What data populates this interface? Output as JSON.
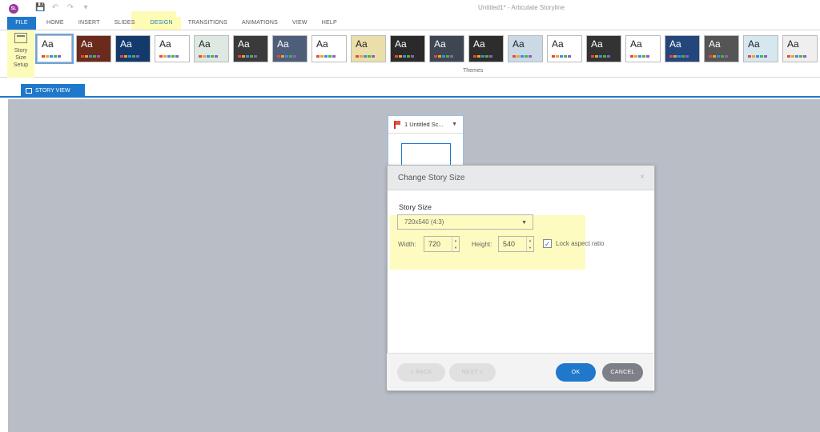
{
  "app": {
    "window_title": "Untitled1* - Articulate Storyline",
    "logo_text": "SL"
  },
  "quick_access": {
    "icons": [
      "save-icon",
      "undo-icon",
      "redo-icon",
      "customize-icon"
    ]
  },
  "tabs": [
    {
      "label": "FILE"
    },
    {
      "label": "HOME"
    },
    {
      "label": "INSERT"
    },
    {
      "label": "SLIDES"
    },
    {
      "label": "DESIGN",
      "active": true
    },
    {
      "label": "TRANSITIONS"
    },
    {
      "label": "ANIMATIONS"
    },
    {
      "label": "VIEW"
    },
    {
      "label": "HELP"
    }
  ],
  "ribbon": {
    "story_size_label_1": "Story",
    "story_size_label_2": "Size",
    "story_size_label_3": "Setup",
    "themes_label": "Themes",
    "themes": [
      {
        "aa": "Aa",
        "bg": "#ffffff",
        "fg": "#222222",
        "selected": true
      },
      {
        "aa": "Aa",
        "bg": "#6a2b1c",
        "fg": "#ffffff"
      },
      {
        "aa": "Aa",
        "bg": "#143a6b",
        "fg": "#ffffff"
      },
      {
        "aa": "Aa",
        "bg": "#ffffff",
        "fg": "#222222"
      },
      {
        "aa": "Aa",
        "bg": "#dde9e1",
        "fg": "#222222"
      },
      {
        "aa": "Aa",
        "bg": "#3a3a3a",
        "fg": "#ffffff"
      },
      {
        "aa": "Aa",
        "bg": "#4e5e78",
        "fg": "#ffffff"
      },
      {
        "aa": "Aa",
        "bg": "#ffffff",
        "fg": "#222222"
      },
      {
        "aa": "Aa",
        "bg": "#eadfaa",
        "fg": "#222222"
      },
      {
        "aa": "Aa",
        "bg": "#2a2a2a",
        "fg": "#ffffff"
      },
      {
        "aa": "Aa",
        "bg": "#3d4652",
        "fg": "#ffffff"
      },
      {
        "aa": "Aa",
        "bg": "#2d2d2d",
        "fg": "#ffffff"
      },
      {
        "aa": "Aa",
        "bg": "#c9d9e6",
        "fg": "#222222"
      },
      {
        "aa": "Aa",
        "bg": "#ffffff",
        "fg": "#222222"
      },
      {
        "aa": "Aa",
        "bg": "#333333",
        "fg": "#ffffff"
      },
      {
        "aa": "Aa",
        "bg": "#ffffff",
        "fg": "#222222"
      },
      {
        "aa": "Aa",
        "bg": "#24467b",
        "fg": "#ffffff"
      },
      {
        "aa": "Aa",
        "bg": "#555555",
        "fg": "#ffffff"
      },
      {
        "aa": "Aa",
        "bg": "#d6e7ef",
        "fg": "#222222"
      },
      {
        "aa": "Aa",
        "bg": "#efefef",
        "fg": "#222222"
      }
    ]
  },
  "story_view_tab": "STORY VIEW",
  "scene": {
    "title": "1 Untitled Sc...",
    "caret": "▼"
  },
  "dialog": {
    "title": "Change Story Size",
    "close": "×",
    "section_label": "Story Size",
    "size_value": "720x540 (4:3)",
    "width_label": "Width:",
    "width_value": "720",
    "height_label": "Height:",
    "height_value": "540",
    "lock_label": "Lock aspect ratio",
    "lock_checked": "✓",
    "buttons": {
      "back": "< BACK",
      "next": "NEXT >",
      "ok": "OK",
      "cancel": "CANCEL"
    }
  },
  "colors": {
    "accent": "#1f78c9",
    "highlight": "#fdfbb8",
    "canvas": "#b8bdc6"
  }
}
